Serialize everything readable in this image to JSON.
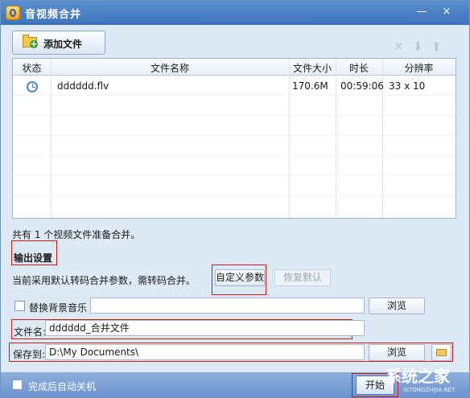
{
  "window": {
    "title": "音视频合并",
    "controls": {
      "close": "×"
    }
  },
  "toolbar": {
    "add_file": "添加文件",
    "right_icons": [
      "close-icon",
      "arrow-down-icon",
      "arrow-up-icon"
    ]
  },
  "table": {
    "headers": [
      "状态",
      "文件名称",
      "文件大小",
      "时长",
      "分辨率"
    ],
    "rows": [
      {
        "status_icon": "clock-icon",
        "name": "dddddd.flv",
        "size": "170.6M",
        "duration": "00:59:06",
        "resolution": "33 x 10"
      }
    ]
  },
  "summary": "共有 1 个视频文件准备合并。",
  "output": {
    "title": "输出设置",
    "desc": "当前采用默认转码合并参数，需转码合并。",
    "custom_params": "自定义参数",
    "restore_default": "恢复默认",
    "bg_music_label": "替换背景音乐",
    "bg_music_value": "",
    "browse": "浏览",
    "filename_label": "文件名:",
    "filename_value": "dddddd_合并文件",
    "saveto_label": "保存到:",
    "saveto_value": "D:\\My Documents\\",
    "folder_icon": "folder-open-icon"
  },
  "footer": {
    "auto_shutdown_label": "完成后自动关机",
    "start_button": "开始",
    "watermark_logo": "系统之家",
    "watermark_site": "XITONGZHIJIA.NET"
  }
}
